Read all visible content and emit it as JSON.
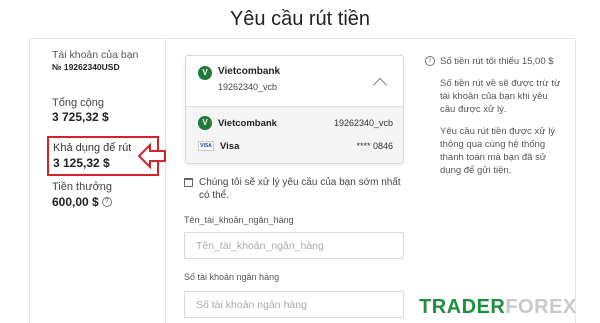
{
  "page": {
    "title": "Yêu cầu rút tiền"
  },
  "account": {
    "label": "Tài khoản của bạn",
    "number": "№ 19262340USD",
    "total_label": "Tổng cộng",
    "total_value": "3 725,32 $",
    "available_label": "Khả dụng để rút",
    "available_value": "3 125,32 $",
    "bonus_label": "Tiền thưởng",
    "bonus_value": "600,00 $"
  },
  "bank_dropdown": {
    "selected": {
      "logo": "V",
      "name": "Vietcombank",
      "account": "19262340_vcb"
    },
    "options": [
      {
        "logo": "V",
        "name": "Vietcombank",
        "account": "19262340_vcb"
      },
      {
        "logo": "VISA",
        "name": "Visa",
        "account": "**** 0846"
      }
    ]
  },
  "notice": "Chúng tôi sẽ xử lý yêu cầu của bạn sớm nhất có thể.",
  "form": {
    "account_name_label": "Tên_tài_khoản_ngân_hàng",
    "account_name_placeholder": "Tên_tài_khoản_ngân_hàng",
    "account_number_label": "Số tài khoản ngân hàng",
    "account_number_placeholder": "Số tài khoản ngân hàng"
  },
  "side_info": {
    "min_amount": "Số tiền rút tối thiểu 15,00 $",
    "deduction": "Số tiền rút về sẽ được trừ từ tài khoản của bạn khi yêu cầu được xử lý.",
    "processing": "Yêu cầu rút tiền được xử lý thông qua cùng hệ thống thanh toán mà bạn đã sử dụng để gửi tiền."
  },
  "watermark": {
    "part1": "TRADER",
    "part2": "FOREX"
  },
  "colors": {
    "highlight": "#d4232a",
    "brand_green": "#1f7a3a"
  }
}
